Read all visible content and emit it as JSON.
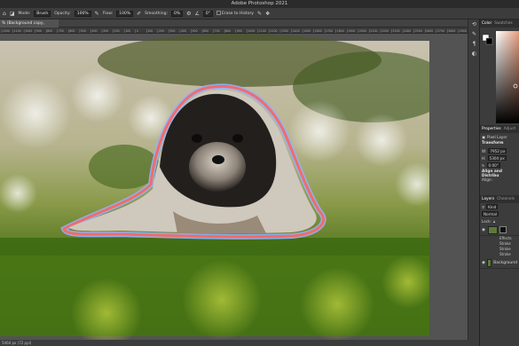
{
  "app": {
    "title": "Adobe Photoshop 2021"
  },
  "options_bar": {
    "mode_label": "Mode:",
    "mode_value": "Brush",
    "opacity_label": "Opacity:",
    "opacity_value": "100%",
    "flow_label": "Flow:",
    "flow_value": "100%",
    "smoothing_label": "Smoothing:",
    "smoothing_value": "0%",
    "angle_value": "0°",
    "erase_history_label": "Erase to History"
  },
  "document": {
    "tab_label": "% (Background copy, RGB/8) *",
    "ruler_ticks": [
      "1200",
      "1100",
      "1000",
      "900",
      "800",
      "700",
      "600",
      "500",
      "400",
      "300",
      "200",
      "100",
      "0",
      "100",
      "200",
      "300",
      "400",
      "500",
      "600",
      "700",
      "800",
      "900",
      "1000",
      "1100",
      "1200",
      "1300",
      "1400",
      "1500",
      "1600",
      "1700",
      "1800",
      "1900",
      "2000",
      "2100",
      "2200",
      "2300",
      "2400",
      "2500",
      "2600",
      "2700",
      "2800",
      "2900",
      "3000"
    ],
    "status": "5464 px (72 ppi)"
  },
  "panels": {
    "color_tabs": [
      "Color",
      "Swatches"
    ],
    "properties_tabs": [
      "Properties",
      "Adjust"
    ],
    "pixel_layer_label": "Pixel Layer",
    "transform_label": "Transform",
    "w_label": "W:",
    "w_value": "7952 px",
    "h_label": "H:",
    "h_value": "5304 px",
    "angle_value": "0.00°",
    "align_label": "Align and Distribu",
    "align_sub": "Align:",
    "layers_tabs": [
      "Layers",
      "Channels"
    ],
    "kind_label": "Kind",
    "blend_mode": "Normal",
    "lock_label": "Lock:",
    "layers": [
      {
        "name": "Background copy",
        "effects_label": "Effects",
        "sub": [
          "Stroke",
          "Stroke",
          "Stroke"
        ]
      },
      {
        "name": "Background"
      }
    ]
  },
  "accent_colors": {
    "inner_stroke": "#f26b6b",
    "outer_stroke": "#8fb4ff"
  }
}
